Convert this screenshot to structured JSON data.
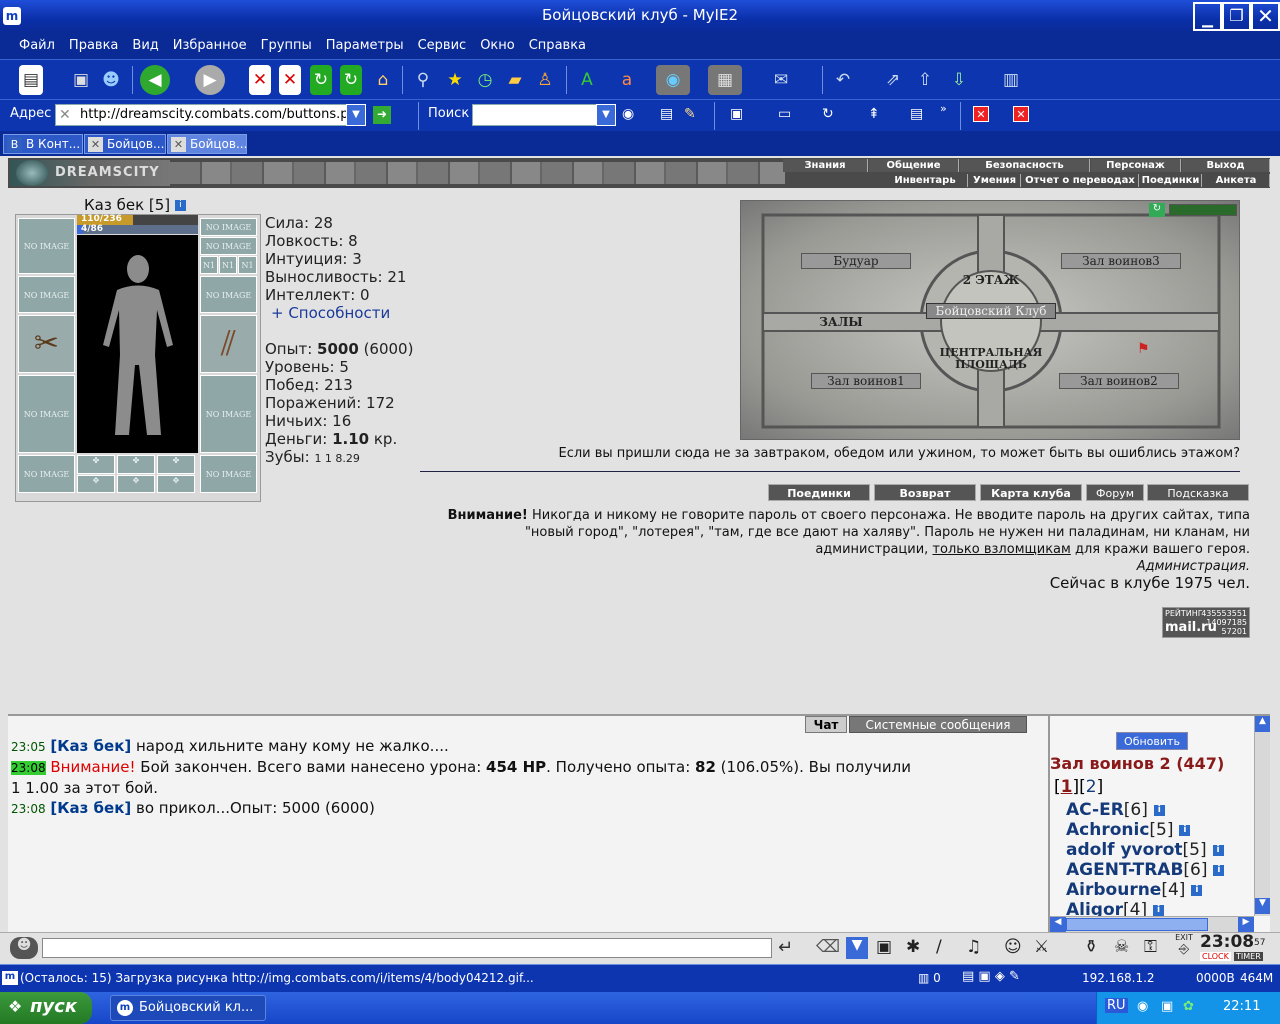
{
  "window": {
    "title": "Бойцовский клуб - MyIE2",
    "icon": "m"
  },
  "menu": [
    "Файл",
    "Правка",
    "Вид",
    "Избранное",
    "Группы",
    "Параметры",
    "Сервис",
    "Окно",
    "Справка"
  ],
  "address": {
    "label": "Адрес",
    "url": "http://dreamscity.combats.com/buttons.p",
    "search_label": "Поиск"
  },
  "tabs": [
    {
      "label": "В Конт..."
    },
    {
      "label": "Бойцов..."
    },
    {
      "label": "Бойцов..."
    }
  ],
  "banner": {
    "logo": "DREAMSCITY",
    "nav_top": [
      "Знания",
      "Общение",
      "Безопасность",
      "Персонаж",
      "Выход"
    ],
    "nav_bottom": [
      "Инвентарь",
      "Умения",
      "Отчет о переводах",
      "Поединки",
      "Анкета"
    ]
  },
  "character": {
    "name": "Каз бек",
    "level": "[5]",
    "hp": "110/236",
    "mana": "4/86",
    "no_image": "NO IMAGE",
    "slot_small": "N1"
  },
  "stats": {
    "strength": "Сила: 28",
    "agility": "Ловкость: 8",
    "intuition": "Интуиция: 3",
    "endurance": "Выносливость: 21",
    "intellect": "Интеллект: 0",
    "abilities": "+ Способности",
    "exp_label": "Опыт:",
    "exp_value": "5000",
    "exp_next": "(6000)",
    "level": "Уровень: 5",
    "wins": "Побед: 213",
    "losses": "Поражений: 172",
    "draws": "Ничьих: 16",
    "money_label": "Деньги:",
    "money_value": "1.10",
    "money_unit": "кр.",
    "teeth_label": "Зубы:",
    "teeth_values": "1  1  8.29"
  },
  "map": {
    "rooms": [
      "Будуар",
      "Зал воинов3",
      "2 ЭТАЖ",
      "Бойцовский Клуб",
      "ЗАЛЫ",
      "ЦЕНТРАЛЬНАЯ ПЛОЩАДЬ",
      "Зал воинов1",
      "Зал воинов2"
    ],
    "hint": "Если вы пришли сюда не за завтраком, обедом или ужином, то может быть вы ошиблись этажом?"
  },
  "room_buttons": [
    "Поединки",
    "Возврат",
    "Карта клуба",
    "Форум",
    "Подсказка"
  ],
  "warning": {
    "bold": "Внимание!",
    "text1": " Никогда и никому не говорите пароль от своего персонажа. Не вводите пароль на других сайтах, типа",
    "text2": "\"новый город\", \"лотерея\", \"там, где все дают на халяву\". Пароль не нужен ни паладинам, ни кланам, ни",
    "text3a": "администрации, ",
    "text3link": "только взломщикам",
    "text3b": " для кражи вашего героя.",
    "sign": "Администрация.",
    "online": "Сейчас в клубе 1975 чел."
  },
  "counter": {
    "label": "РЕЙТИНГ",
    "brand": "mail.ru",
    "n1": "435553551",
    "n2": "14097185",
    "n3": "57201"
  },
  "chat": {
    "tabs": [
      "Чат",
      "Системные сообщения"
    ],
    "lines": [
      {
        "time": "23:05",
        "nick": "[Каз бек]",
        "text": " народ хильните ману кому не жалко...."
      },
      {
        "time": "23:08",
        "alert": "Внимание!",
        "text": " Бой закончен. Всего вами нанесено урона: ",
        "dmg": "454 HP",
        "text2": ". Получено опыта: ",
        "exp": "82",
        "text3": " (106.05%). Вы получили",
        "line2": "1  1.00 за этот бой."
      },
      {
        "time": "23:08",
        "nick": "[Каз бек]",
        "text": " во прикол...Опыт: 5000 (6000)"
      }
    ]
  },
  "who": {
    "refresh": "Обновить",
    "room": "Зал воинов 2 (447)",
    "pages": [
      "1",
      "2"
    ],
    "users": [
      {
        "name": "AC-ER",
        "lvl": "[6]"
      },
      {
        "name": "Achronic",
        "lvl": "[5]"
      },
      {
        "name": "adolf yvorot",
        "lvl": "[5]"
      },
      {
        "name": "AGENT-TRAB",
        "lvl": "[6]"
      },
      {
        "name": "Airbourne",
        "lvl": "[4]"
      },
      {
        "name": "Aligor",
        "lvl": "[4]"
      }
    ]
  },
  "clock": {
    "time": "23:08",
    "sec": "57",
    "clock_lbl": "CLOCK",
    "timer_lbl": "TIMER",
    "exit": "EXIT"
  },
  "status": {
    "text": "(Осталось: 15) Загрузка рисунка http://img.combats.com/i/items/4/body04212.gif...",
    "count": "0",
    "ip": "192.168.1.2",
    "traffic": "0000B",
    "mem": "464M"
  },
  "taskbar": {
    "start": "пуск",
    "task": "Бойцовский кл...",
    "lang": "RU",
    "time": "22:11"
  }
}
